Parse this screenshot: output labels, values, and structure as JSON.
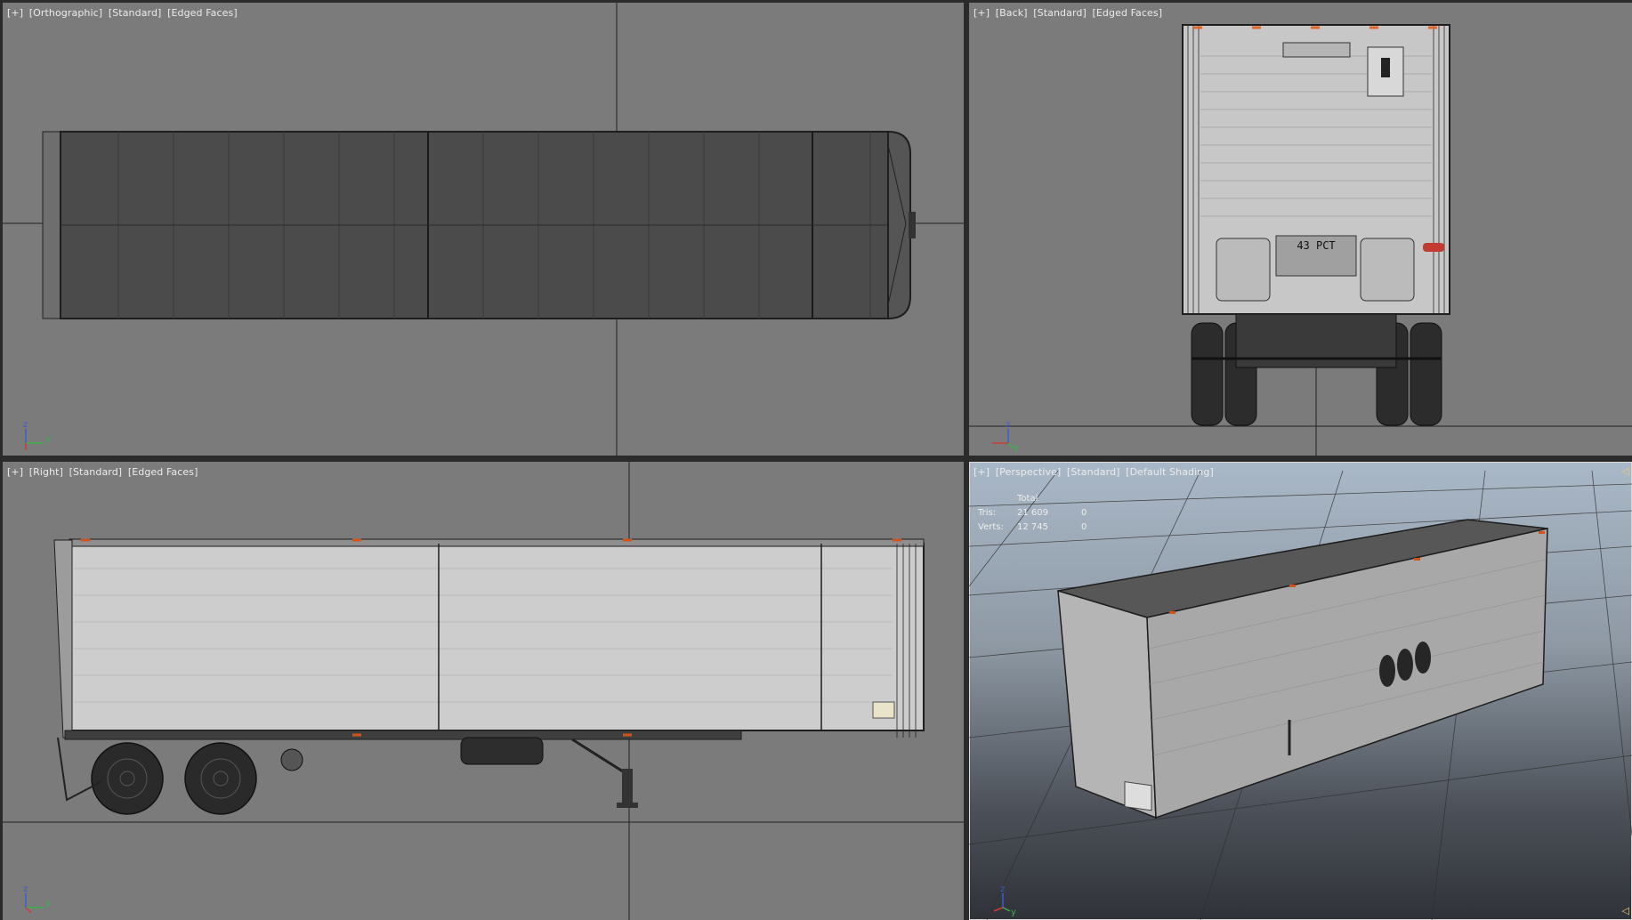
{
  "viewports": {
    "top": {
      "label": [
        "[+]",
        "[Orthographic]",
        "[Standard]",
        "[Edged Faces]"
      ],
      "axis": {
        "a": "z",
        "b": "y"
      }
    },
    "back": {
      "label": [
        "[+]",
        "[Back]",
        "[Standard]",
        "[Edged Faces]"
      ],
      "axis": {
        "a": "z",
        "b": "y"
      },
      "plate": "43 PCT"
    },
    "right": {
      "label": [
        "[+]",
        "[Right]",
        "[Standard]",
        "[Edged Faces]"
      ],
      "axis": {
        "a": "z",
        "b": "y"
      }
    },
    "perspective": {
      "label": [
        "[+]",
        "[Perspective]",
        "[Standard]",
        "[Default Shading]"
      ],
      "axis": {
        "a": "z",
        "b": "y"
      },
      "stats": {
        "header": "Total",
        "tris_label": "Tris:",
        "tris_value": "21 609",
        "tris_sel": "0",
        "verts_label": "Verts:",
        "verts_value": "12 745",
        "verts_sel": "0"
      }
    }
  },
  "colors": {
    "viewport_bg": "#7b7b7b",
    "trailer_body": "#c9c9c9",
    "trailer_dark": "#4a4a4a",
    "wire": "#222222",
    "marker_light": "#d0541c"
  }
}
